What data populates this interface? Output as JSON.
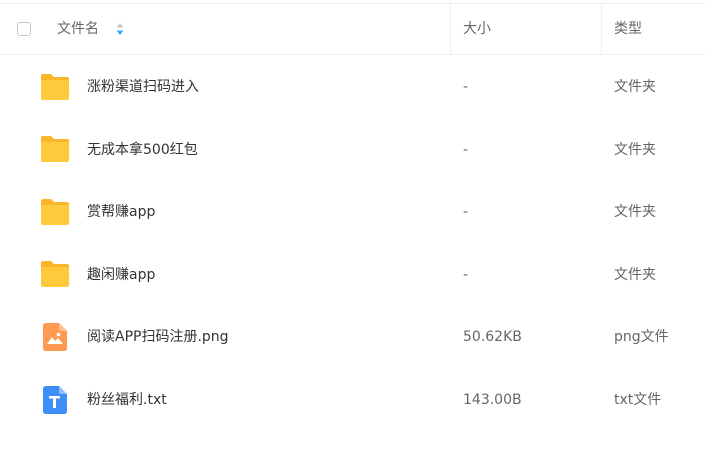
{
  "header": {
    "name_label": "文件名",
    "size_label": "大小",
    "type_label": "类型"
  },
  "files": [
    {
      "name": "涨粉渠道扫码进入",
      "size": "-",
      "type": "文件夹",
      "icon": "folder-icon"
    },
    {
      "name": "无成本拿500红包",
      "size": "-",
      "type": "文件夹",
      "icon": "folder-icon"
    },
    {
      "name": "赏帮赚app",
      "size": "-",
      "type": "文件夹",
      "icon": "folder-icon"
    },
    {
      "name": "趣闲赚app",
      "size": "-",
      "type": "文件夹",
      "icon": "folder-icon"
    },
    {
      "name": "阅读APP扫码注册.png",
      "size": "50.62KB",
      "type": "png文件",
      "icon": "image-file-icon"
    },
    {
      "name": "粉丝福利.txt",
      "size": "143.00B",
      "type": "txt文件",
      "icon": "text-file-icon"
    }
  ],
  "colors": {
    "folder": "#FFC93C",
    "folder_back": "#FBB52A",
    "image_file": "#FF9A52",
    "text_file": "#3D8EF7",
    "sort_active": "#2DA8FF",
    "divider": "#EEEEEE"
  }
}
